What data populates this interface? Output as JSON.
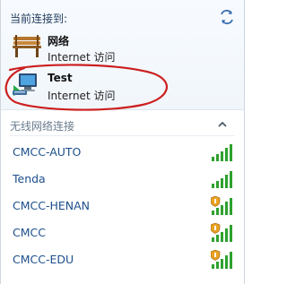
{
  "connected": {
    "header": "当前连接到:",
    "networks": [
      {
        "name": "网络",
        "status": "Internet 访问",
        "icon": "bench-network-icon"
      },
      {
        "name": "Test",
        "status": "Internet 访问",
        "icon": "computer-network-icon"
      }
    ]
  },
  "wireless": {
    "header": "无线网络连接",
    "networks": [
      {
        "name": "CMCC-AUTO",
        "secured": false,
        "signal_bars": 5
      },
      {
        "name": "Tenda",
        "secured": false,
        "signal_bars": 5
      },
      {
        "name": "CMCC-HENAN",
        "secured": true,
        "signal_bars": 5
      },
      {
        "name": "CMCC",
        "secured": true,
        "signal_bars": 5
      },
      {
        "name": "CMCC-EDU",
        "secured": true,
        "signal_bars": 5
      }
    ]
  },
  "colors": {
    "header_text": "#1e395b",
    "wifi_link": "#1d4f8c",
    "signal_green": "#2ea12e",
    "annotation_red": "#cc1f1f",
    "shield_orange": "#e8a120"
  }
}
